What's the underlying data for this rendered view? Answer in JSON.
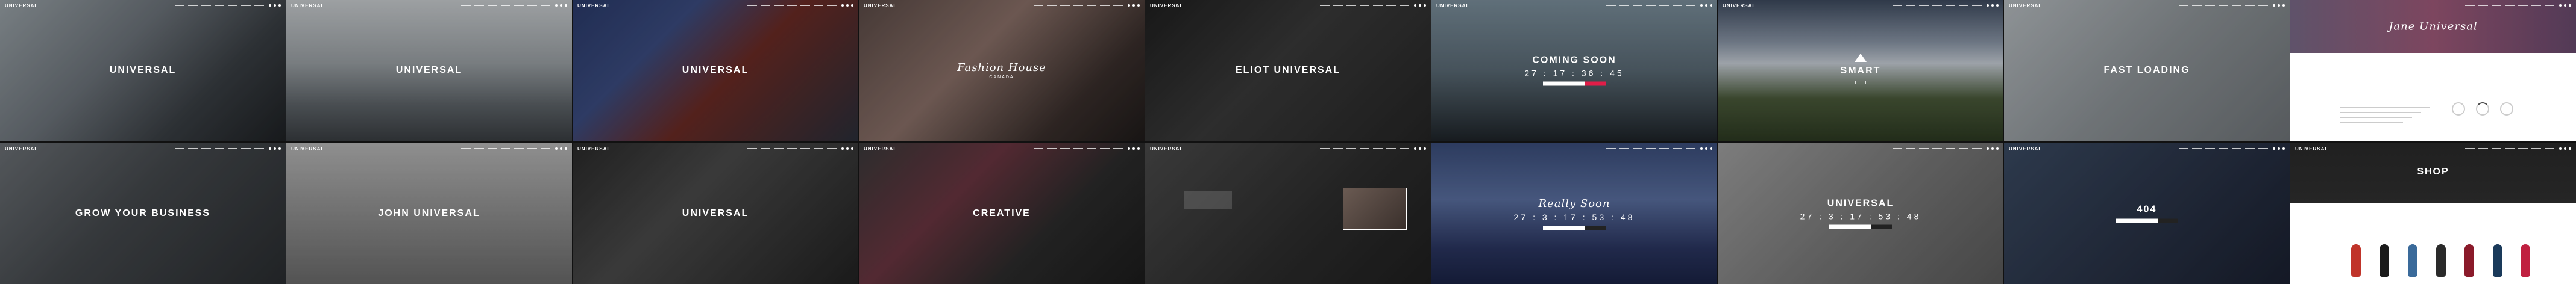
{
  "tiles": [
    {
      "logo": "UNIVERSAL",
      "title": "UNIVERSAL",
      "subtitle": "",
      "button": "",
      "countdown": "",
      "style": "title",
      "bg": "linear-gradient(135deg,#9aa3a8 0%,#6c737a 40%,#3a3f44 70%,#1e2124 100%)"
    },
    {
      "logo": "UNIVERSAL",
      "title": "UNIVERSAL",
      "subtitle": "",
      "button": "",
      "countdown": "",
      "style": "title",
      "bg": "linear-gradient(180deg,#c9cdd0 0%,#9aa0a4 45%,#5d6368 75%,#3a3e42 100%)"
    },
    {
      "logo": "UNIVERSAL",
      "title": "UNIVERSAL",
      "subtitle": "",
      "button": "",
      "countdown": "",
      "style": "title",
      "bg": "linear-gradient(135deg,#2a3a6a 0%,#3b4c80 30%,#6b2b25 55%,#2b2f3a 100%)"
    },
    {
      "logo": "UNIVERSAL",
      "title": "Fashion House",
      "subtitle": "CANADA",
      "button": "",
      "countdown": "",
      "style": "script",
      "bg": "linear-gradient(135deg,#5a4a46 0%,#8a7068 40%,#3a2f2c 75%,#1f1b1a 100%)"
    },
    {
      "logo": "UNIVERSAL",
      "title": "ELIOT UNIVERSAL",
      "subtitle": "",
      "button": "",
      "countdown": "",
      "style": "title",
      "bg": "linear-gradient(135deg,#1f1f1f 0%,#3a3a3a 45%,#252525 100%)"
    },
    {
      "logo": "UNIVERSAL",
      "title": "COMING SOON",
      "subtitle": "",
      "button": "",
      "countdown": "27 : 17 : 36 : 45",
      "style": "countdown-red",
      "bg": "linear-gradient(180deg,#7b8f9c 0%,#5a6a75 50%,#1e2429 100%)"
    },
    {
      "logo": "UNIVERSAL",
      "title": "SMART",
      "subtitle": "",
      "button": "",
      "countdown": "",
      "style": "smart",
      "bg": "linear-gradient(180deg,#3d4a5e 0%,#8b97a8 30%,#c9d0d8 45%,#4a5a3a 70%,#2d3a22 100%)"
    },
    {
      "logo": "UNIVERSAL",
      "title": "FAST LOADING",
      "subtitle": "",
      "button": "",
      "countdown": "",
      "style": "title",
      "bg": "linear-gradient(135deg,#b6bcc0 0%,#8d9397 50%,#6f7478 100%)"
    },
    {
      "logo": "",
      "title": "Jane Universal",
      "subtitle": "",
      "button": "",
      "countdown": "",
      "style": "jane",
      "bg": "linear-gradient(90deg,#7a6a88 0%,#a05a7a 50%,#6a4b6f 100%)"
    },
    {
      "logo": "UNIVERSAL",
      "title": "GROW YOUR BUSINESS",
      "subtitle": "",
      "button": "",
      "countdown": "",
      "style": "title",
      "bg": "linear-gradient(135deg,#6b7075 0%,#44484c 45%,#2a2d30 100%)"
    },
    {
      "logo": "UNIVERSAL",
      "title": "JOHN UNIVERSAL",
      "subtitle": "",
      "button": "",
      "countdown": "",
      "style": "title",
      "bg": "linear-gradient(180deg,#b7b7b7 0%,#8c8c8c 55%,#6b6b6b 100%)"
    },
    {
      "logo": "UNIVERSAL",
      "title": "UNIVERSAL",
      "subtitle": "",
      "button": "",
      "countdown": "",
      "style": "title",
      "bg": "linear-gradient(135deg,#2a2a2a 0%,#4a4a4a 40%,#222 100%)"
    },
    {
      "logo": "UNIVERSAL",
      "title": "CREATIVE",
      "subtitle": "",
      "button": "",
      "countdown": "",
      "style": "title",
      "bg": "linear-gradient(135deg,#3a3a3a 0%,#6a3540 35%,#2c2c2c 65%,#1c1c1c 100%)"
    },
    {
      "logo": "UNIVERSAL",
      "title": "",
      "subtitle": "",
      "button": "",
      "countdown": "",
      "style": "video",
      "bg": "linear-gradient(135deg,#4a4a4a 0%,#2c2c2c 60%,#1f1f1f 100%)"
    },
    {
      "logo": "",
      "title": "Really Soon",
      "subtitle": "",
      "button": "",
      "countdown": "27 : 3 : 17 : 53 : 48",
      "style": "countdown-dark",
      "bg": "linear-gradient(180deg,#3a4d7a 0%,#5a6fa0 40%,#2a3560 75%,#1a2345 100%)"
    },
    {
      "logo": "",
      "title": "UNIVERSAL",
      "subtitle": "",
      "button": "",
      "countdown": "27 : 3 : 17 : 53 : 48",
      "style": "countdown-plain",
      "bg": "linear-gradient(135deg,#a0a0a0 0%,#7a7a7a 50%,#5a5a5a 100%)"
    },
    {
      "logo": "UNIVERSAL",
      "title": "404",
      "subtitle": "",
      "button": "",
      "countdown": "",
      "style": "404",
      "bg": "linear-gradient(135deg,#3a4a62 0%,#2a3448 50%,#1a2030 100%)"
    },
    {
      "logo": "UNIVERSAL",
      "title": "SHOP",
      "subtitle": "",
      "button": "",
      "countdown": "",
      "style": "shop",
      "bg": "linear-gradient(180deg,#2a2a2a 0%,#3a3a3a 100%)"
    }
  ],
  "colors": {
    "accent": "#e11d48"
  },
  "icons": {
    "smart": "bird-icon",
    "nav_menu": "menu-icon"
  }
}
